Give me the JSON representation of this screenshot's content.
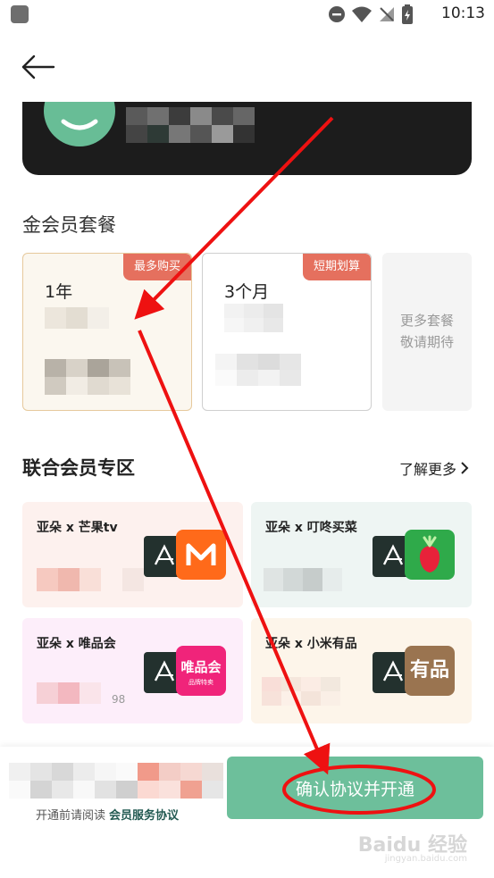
{
  "status_bar": {
    "time": "10:13"
  },
  "section": {
    "title": "金会员套餐"
  },
  "packages": [
    {
      "name": "1年",
      "badge": "最多购买"
    },
    {
      "name": "3个月",
      "badge": "短期划算"
    },
    {
      "more_line1": "更多套餐",
      "more_line2": "敬请期待"
    }
  ],
  "union": {
    "title": "联合会员专区",
    "learn_more": "了解更多",
    "cards": [
      {
        "title": "亚朵 x 芒果tv"
      },
      {
        "title": "亚朵 x 叮咚买菜"
      },
      {
        "title": "亚朵 x 唯品会",
        "logo_text": "唯品会",
        "logo_sub": "品牌特卖",
        "price_hint": "98"
      },
      {
        "title": "亚朵 x 小米有品",
        "logo_text": "有品"
      }
    ]
  },
  "bottom": {
    "agree_prefix": "开通前请阅读",
    "agree_link": "会员服务协议",
    "confirm_label": "确认协议并开通"
  },
  "watermark": {
    "main": "Baidu 经验",
    "sub": "jingyan.baidu.com"
  },
  "colors": {
    "accent_green": "#6dbf9b",
    "badge_red": "#e5705e",
    "annotation_red": "#ee1111"
  }
}
